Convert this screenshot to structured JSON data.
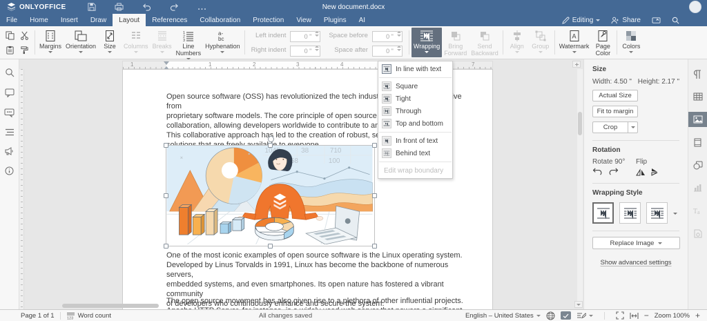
{
  "app": {
    "brand": "ONLYOFFICE",
    "title": "New document.docx",
    "more": "..."
  },
  "header": {
    "tabs": [
      "File",
      "Home",
      "Insert",
      "Draw",
      "Layout",
      "References",
      "Collaboration",
      "Protection",
      "View",
      "Plugins",
      "AI"
    ],
    "editing_label": "Editing",
    "share_label": "Share"
  },
  "toolbar": {
    "margins": "Margins",
    "orientation": "Orientation",
    "size": "Size",
    "columns": "Columns",
    "breaks": "Breaks",
    "line_numbers": "Line\nNumbers",
    "hyphenation": "Hyphenation",
    "left_indent": {
      "label": "Left indent",
      "value": "0 \""
    },
    "right_indent": {
      "label": "Right indent",
      "value": "0 \""
    },
    "space_before": {
      "label": "Space before",
      "value": "0 \""
    },
    "space_after": {
      "label": "Space after",
      "value": "0 \""
    },
    "wrapping": "Wrapping",
    "bring_forward": "Bring\nForward",
    "send_backward": "Send\nBackward",
    "align": "Align",
    "group": "Group",
    "watermark": "Watermark",
    "page_color": "Page\nColor",
    "colors": "Colors"
  },
  "wrapping_menu": {
    "items": [
      {
        "label": "In line with text",
        "selected": true
      },
      {
        "label": "Square"
      },
      {
        "label": "Tight"
      },
      {
        "label": "Through"
      },
      {
        "label": "Top and bottom"
      },
      {
        "label": "In front of text"
      },
      {
        "label": "Behind text"
      },
      {
        "label": "Edit wrap boundary",
        "disabled": true
      }
    ]
  },
  "document": {
    "paragraph1": "Open source software (OSS) has revolutionized the tech industry, offering an alternative from\nproprietary software models. The core principle of open source is transparency and\ncollaboration, allowing developers worldwide to contribute to and improve the code.\nThis collaborative approach has led to the creation of robust, secure, and innovative\nsolutions that are freely available to everyone.",
    "paragraph2": "One of the most iconic examples of open source software is the Linux operating system.\nDeveloped by Linus Torvalds in 1991, Linux has become the backbone of numerous servers,\nembedded systems, and even smartphones. Its open nature has fostered a vibrant community\nof developers who continuously enhance and secure the system.",
    "paragraph3": "The open source movement has also given rise to a plethora of other influential projects.\nApache HTTP Server, for instance, is a widely used web server that powers a significant portion",
    "illustration_numbers": {
      "n1": "1045",
      "n2": "38",
      "n3": "710",
      "n4": "258",
      "n5": "100"
    },
    "ruler_numbers": [
      "1",
      "1",
      "2",
      "3",
      "4",
      "5",
      "6",
      "7"
    ]
  },
  "right_panel": {
    "size_title": "Size",
    "width_label": "Width: 4.50 \"",
    "height_label": "Height: 2.17 \"",
    "actual_size": "Actual Size",
    "fit_to_margin": "Fit to margin",
    "crop": "Crop",
    "rotation_title": "Rotation",
    "rotate_label": "Rotate 90°",
    "flip_label": "Flip",
    "wrapping_style_title": "Wrapping Style",
    "replace_image": "Replace Image",
    "advanced_settings": "Show advanced settings"
  },
  "status_bar": {
    "page": "Page 1 of 1",
    "word_count": "Word count",
    "saved": "All changes saved",
    "language": "English – United States",
    "zoom_label": "Zoom 100%",
    "zoom_out": "−",
    "zoom_in": "+"
  },
  "colors": {
    "header": "#446995",
    "pressed": "#636f7e",
    "active_tile": "#77828d"
  }
}
